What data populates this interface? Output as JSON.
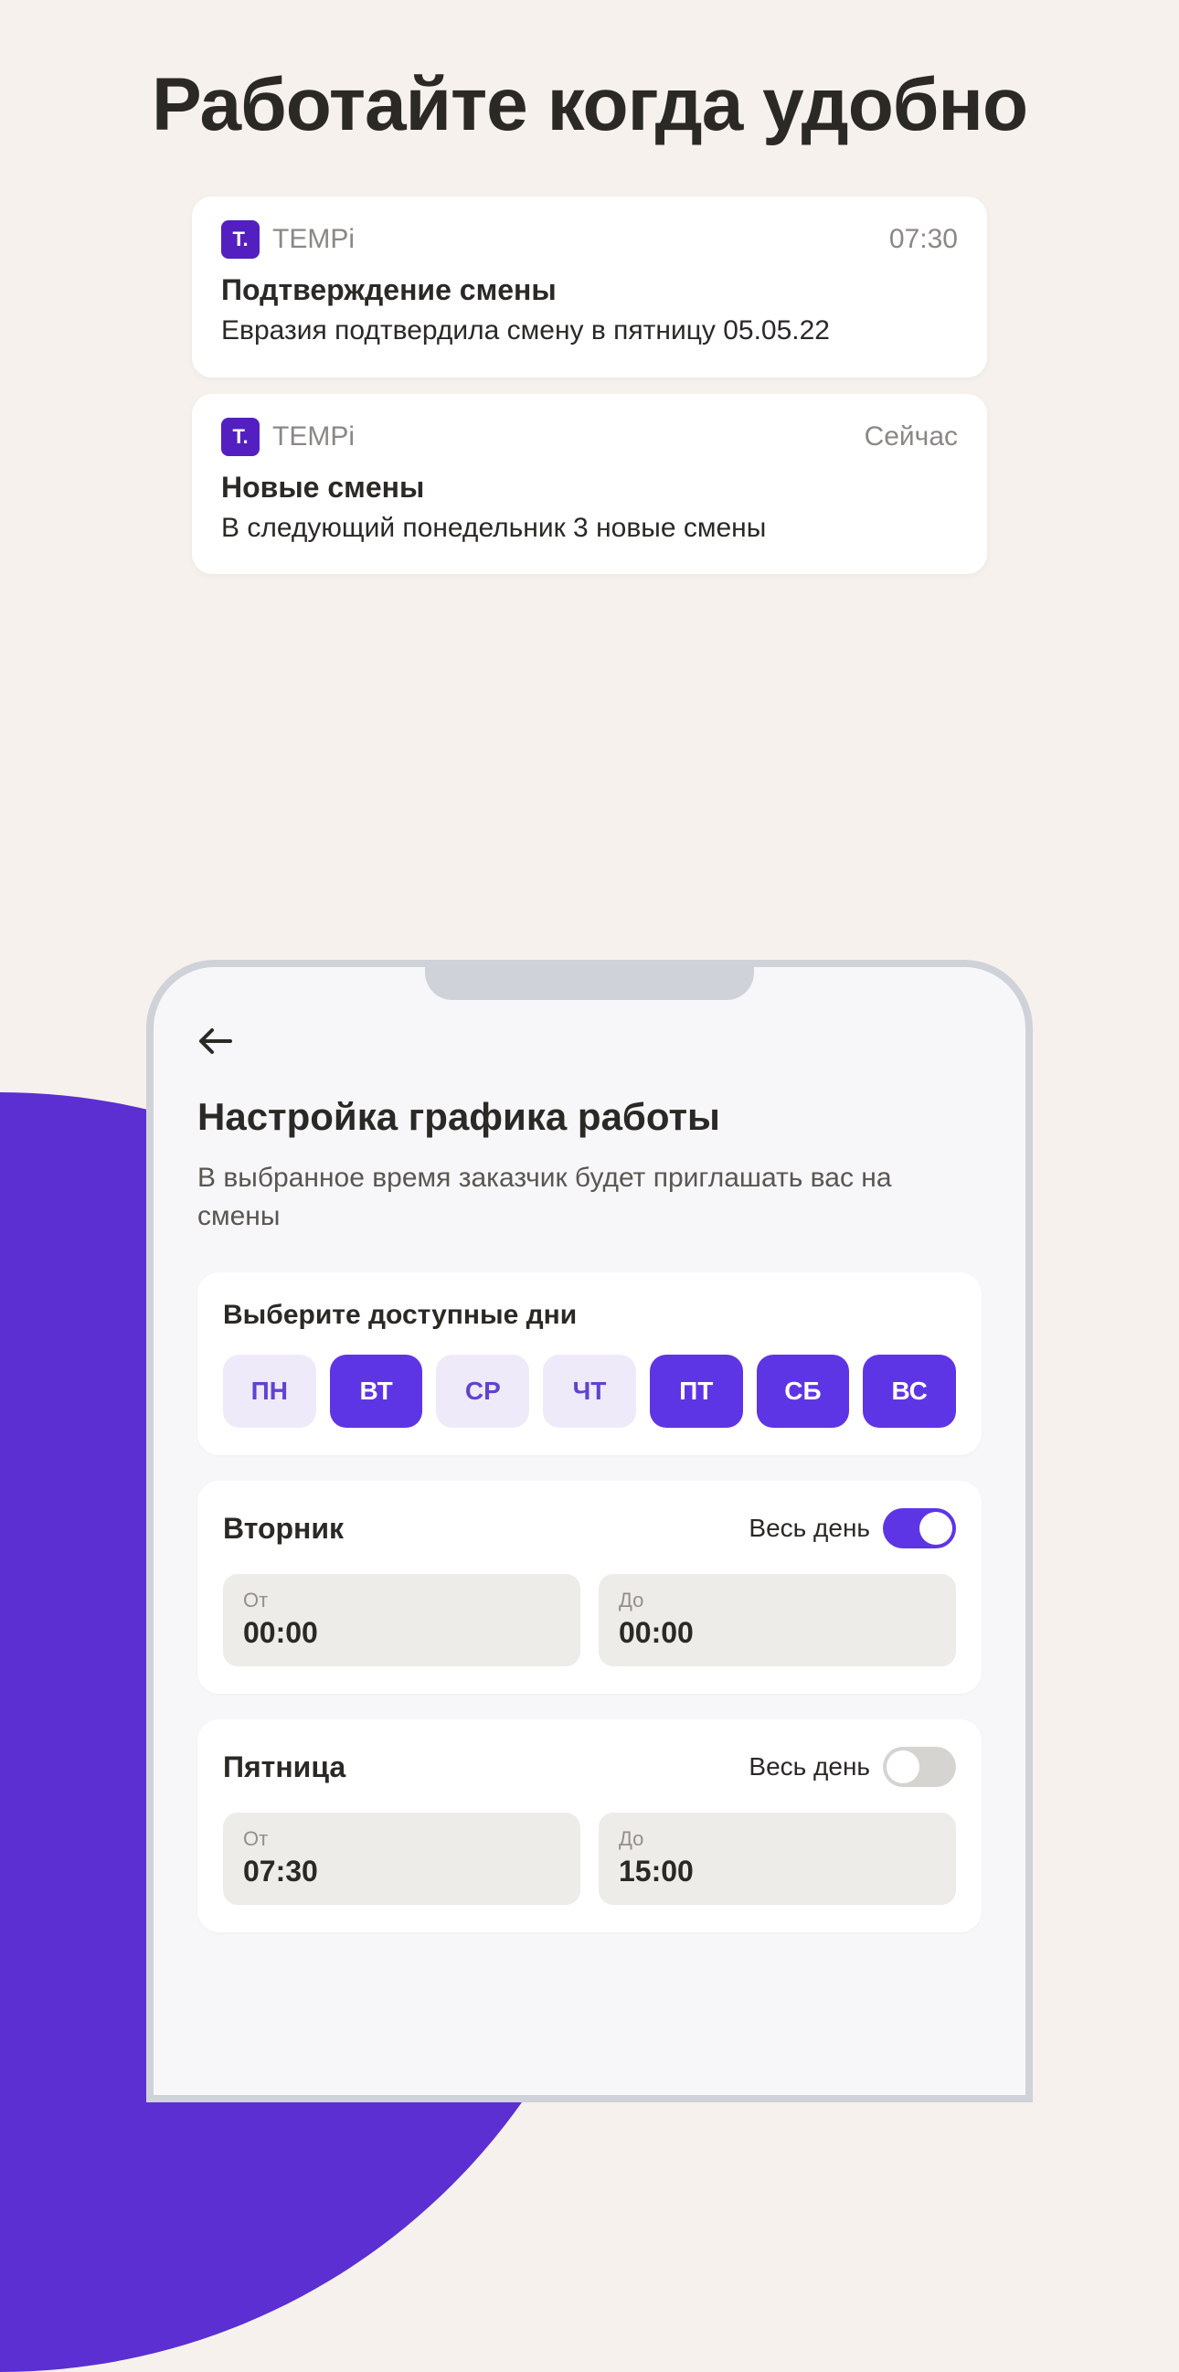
{
  "page_title": "Работайте когда удобно",
  "notifications": [
    {
      "app_icon_letter": "T.",
      "app_name": "TEMPi",
      "time": "07:30",
      "title": "Подтверждение смены",
      "body": "Евразия подтвердила смену в пятницу 05.05.22"
    },
    {
      "app_icon_letter": "T.",
      "app_name": "TEMPi",
      "time": "Сейчас",
      "title": "Новые смены",
      "body": "В следующий понедельник 3 новые смены"
    }
  ],
  "schedule_screen": {
    "title": "Настройка графика работы",
    "subtitle": "В выбранное время заказчик будет приглашать вас на смены",
    "available_days_title": "Выберите доступные дни",
    "days": [
      {
        "label": "ПН",
        "active": false
      },
      {
        "label": "ВТ",
        "active": true
      },
      {
        "label": "СР",
        "active": false
      },
      {
        "label": "ЧТ",
        "active": false
      },
      {
        "label": "ПТ",
        "active": true
      },
      {
        "label": "СБ",
        "active": true
      },
      {
        "label": "ВС",
        "active": true
      }
    ],
    "day_rows": [
      {
        "name": "Вторник",
        "allday_label": "Весь день",
        "allday_on": true,
        "from_label": "От",
        "from_value": "00:00",
        "to_label": "До",
        "to_value": "00:00"
      },
      {
        "name": "Пятница",
        "allday_label": "Весь день",
        "allday_on": false,
        "from_label": "От",
        "from_value": "07:30",
        "to_label": "До",
        "to_value": "15:00"
      }
    ]
  }
}
